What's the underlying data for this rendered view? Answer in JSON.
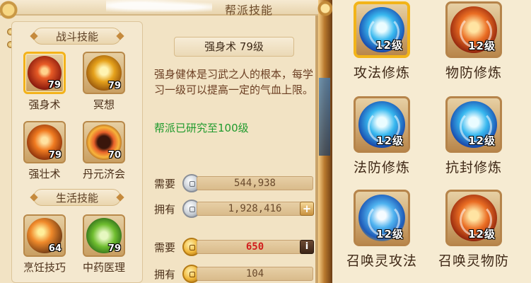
{
  "header": {
    "title": "帮派技能"
  },
  "sections": {
    "combat": "战斗技能",
    "life": "生活技能"
  },
  "combat_skills": [
    {
      "name": "强身术",
      "level": "79",
      "icon": "strength-skill-icon"
    },
    {
      "name": "冥想",
      "level": "79",
      "icon": "meditation-skill-icon"
    },
    {
      "name": "强壮术",
      "level": "79",
      "icon": "vigor-skill-icon"
    },
    {
      "name": "丹元济会",
      "level": "70",
      "icon": "elixir-skill-icon"
    }
  ],
  "life_skills": [
    {
      "name": "烹饪技巧",
      "level": "64",
      "icon": "cooking-skill-icon"
    },
    {
      "name": "中药医理",
      "level": "79",
      "icon": "medicine-skill-icon"
    }
  ],
  "detail": {
    "title": "强身术  79级",
    "description": "强身健体是习武之人的根本，每学习一级可以提高一定的气血上限。",
    "research": "帮派已研究至100级"
  },
  "costs": [
    {
      "label": "需要",
      "currency": "silver-coin-icon",
      "value": "544,938"
    },
    {
      "label": "拥有",
      "currency": "silver-coin-icon",
      "value": "1,928,416",
      "button": "+"
    },
    {
      "label": "需要",
      "currency": "contribution-coin-icon",
      "value": "650",
      "button": "i"
    },
    {
      "label": "拥有",
      "currency": "contribution-coin-icon",
      "value": "104"
    }
  ],
  "practice": [
    {
      "name": "攻法修炼",
      "level": "12级",
      "icon": "magic-attack-practice-icon"
    },
    {
      "name": "物防修炼",
      "level": "12级",
      "icon": "physical-defense-practice-icon"
    },
    {
      "name": "法防修炼",
      "level": "12级",
      "icon": "magic-defense-practice-icon"
    },
    {
      "name": "抗封修炼",
      "level": "12级",
      "icon": "seal-resist-practice-icon"
    },
    {
      "name": "召唤灵攻法",
      "level": "12级",
      "icon": "summon-magic-attack-practice-icon"
    },
    {
      "name": "召唤灵物防",
      "level": "12级",
      "icon": "summon-physical-defense-practice-icon"
    }
  ]
}
